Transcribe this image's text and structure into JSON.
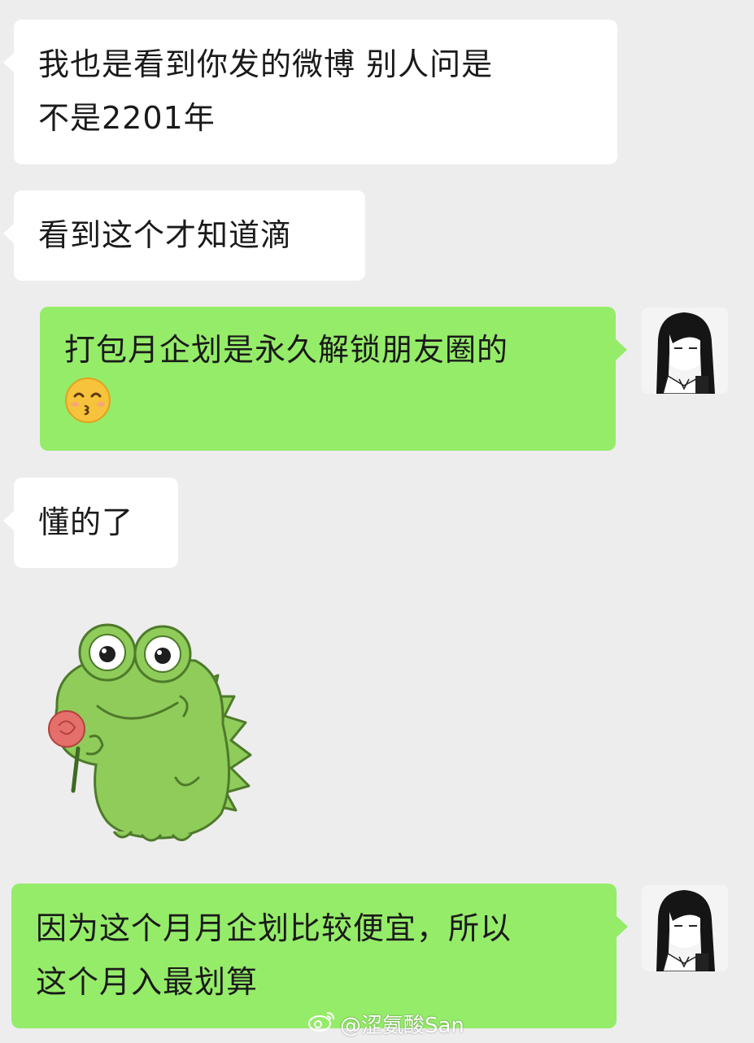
{
  "messages": [
    {
      "lines": [
        "我也是看到你发的微博 别人问是",
        "不是2201年"
      ]
    },
    {
      "lines": [
        "看到这个才知道滴"
      ]
    },
    {
      "lines": [
        "打包月企划是永久解锁朋友圈的"
      ],
      "emoji": "smiling-kiss-emoji"
    },
    {
      "lines": [
        "懂的了"
      ]
    },
    {
      "sticker": "frog-holding-rose-sticker"
    },
    {
      "lines": [
        "因为这个月月企划比较便宜，所以",
        "这个月入最划算"
      ]
    }
  ],
  "watermark": {
    "text": "@涩氨酸San",
    "icon": "weibo-icon"
  },
  "colors": {
    "background": "#ededed",
    "incoming_bubble": "#ffffff",
    "outgoing_bubble": "#95ec69",
    "frog_green": "#8fcc5a"
  }
}
